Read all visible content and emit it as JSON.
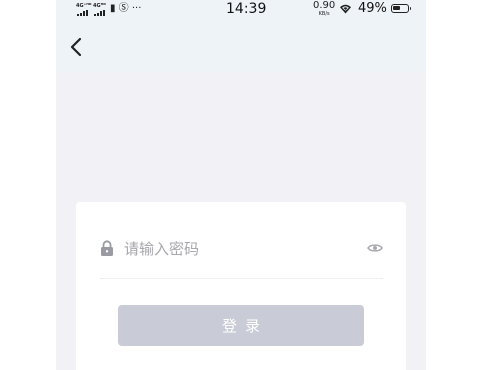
{
  "status_bar": {
    "network_1": "4G⁺ᴴᴰ",
    "network_2": "4Gᴴᴰ",
    "status_icons": "▮ Ⓢ ···",
    "time": "14:39",
    "speed_value": "0.90",
    "speed_unit": "KB/s",
    "battery_percent": "49%",
    "battery_level": 0.49
  },
  "header": {
    "back_icon": "chevron-left-icon"
  },
  "form": {
    "lock_icon": "lock-icon",
    "password_placeholder": "请输入密码",
    "password_value": "",
    "visibility_icon": "eye-icon",
    "login_label": "登录"
  },
  "colors": {
    "page_background": "#f2f2f6",
    "header_background": "#eef3f8",
    "card_background": "#ffffff",
    "disabled_button": "#c9ccd6",
    "placeholder_text": "#a7a7ad"
  }
}
